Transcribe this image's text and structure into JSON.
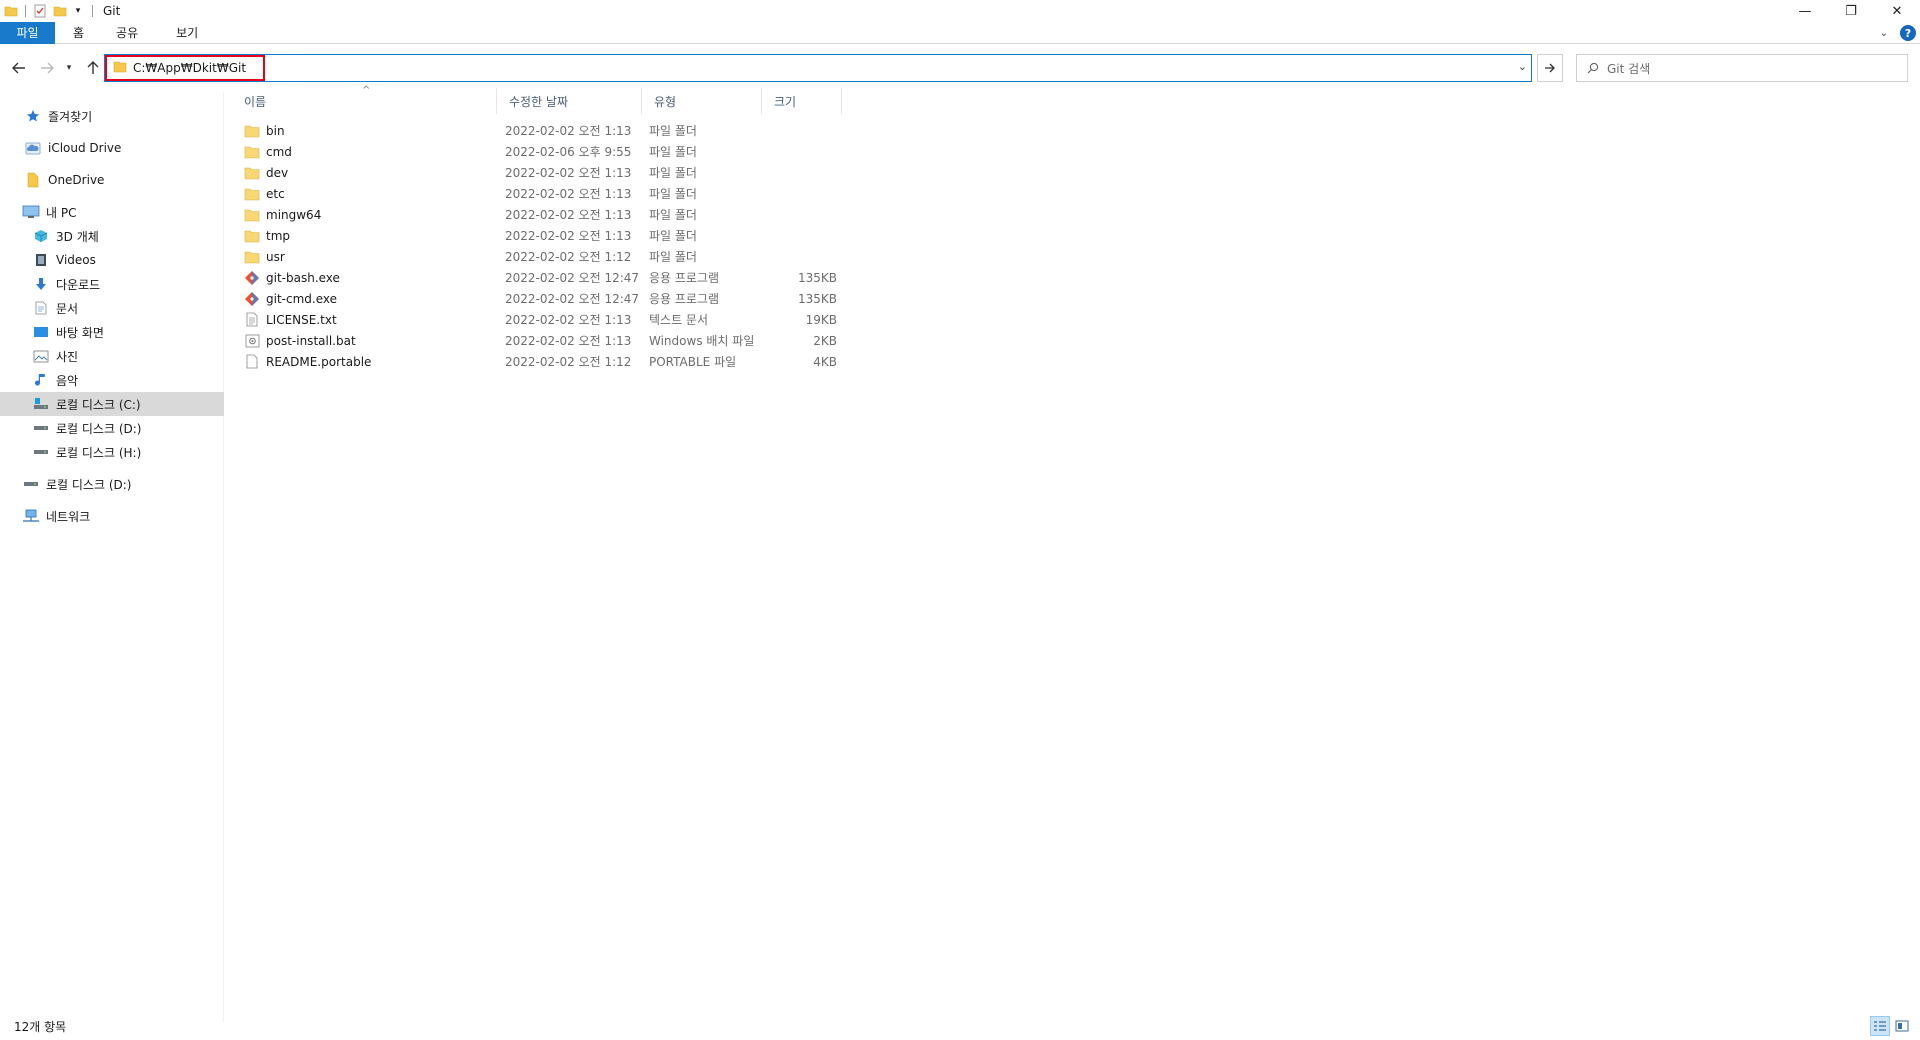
{
  "window": {
    "title": "Git",
    "controls": {
      "minimize": "—",
      "maximize": "❐",
      "close": "✕"
    }
  },
  "ribbon": {
    "tabs": [
      "파일",
      "홈",
      "공유",
      "보기"
    ],
    "help_label": "?"
  },
  "nav": {
    "address_path": "C:₩App₩Dkit₩Git",
    "search_placeholder": "Git 검색"
  },
  "sidebar": {
    "items": [
      {
        "label": "즐겨찾기",
        "icon": "star-icon"
      },
      {
        "label": "iCloud Drive",
        "icon": "icloud-icon"
      },
      {
        "label": "OneDrive",
        "icon": "folder-icon"
      },
      {
        "label": "내 PC",
        "icon": "pc-icon"
      },
      {
        "label": "3D 개체",
        "icon": "cube-icon"
      },
      {
        "label": "Videos",
        "icon": "video-icon"
      },
      {
        "label": "다운로드",
        "icon": "download-icon"
      },
      {
        "label": "문서",
        "icon": "document-icon"
      },
      {
        "label": "바탕 화면",
        "icon": "desktop-icon"
      },
      {
        "label": "사진",
        "icon": "pictures-icon"
      },
      {
        "label": "음악",
        "icon": "music-icon"
      },
      {
        "label": "로컬 디스크 (C:)",
        "icon": "drive-c-icon",
        "selected": true
      },
      {
        "label": "로컬 디스크 (D:)",
        "icon": "drive-icon"
      },
      {
        "label": "로컬 디스크 (H:)",
        "icon": "drive-icon"
      },
      {
        "label": "로컬 디스크 (D:)",
        "icon": "drive-icon"
      },
      {
        "label": "네트워크",
        "icon": "network-icon"
      }
    ]
  },
  "columns": {
    "name": "이름",
    "date": "수정한 날짜",
    "type": "유형",
    "size": "크기"
  },
  "files": [
    {
      "name": "bin",
      "date": "2022-02-02 오전 1:13",
      "type": "파일 폴더",
      "size": "",
      "icon": "folder-icon"
    },
    {
      "name": "cmd",
      "date": "2022-02-06 오후 9:55",
      "type": "파일 폴더",
      "size": "",
      "icon": "folder-icon"
    },
    {
      "name": "dev",
      "date": "2022-02-02 오전 1:13",
      "type": "파일 폴더",
      "size": "",
      "icon": "folder-icon"
    },
    {
      "name": "etc",
      "date": "2022-02-02 오전 1:13",
      "type": "파일 폴더",
      "size": "",
      "icon": "folder-icon"
    },
    {
      "name": "mingw64",
      "date": "2022-02-02 오전 1:13",
      "type": "파일 폴더",
      "size": "",
      "icon": "folder-icon"
    },
    {
      "name": "tmp",
      "date": "2022-02-02 오전 1:13",
      "type": "파일 폴더",
      "size": "",
      "icon": "folder-icon"
    },
    {
      "name": "usr",
      "date": "2022-02-02 오전 1:12",
      "type": "파일 폴더",
      "size": "",
      "icon": "folder-icon"
    },
    {
      "name": "git-bash.exe",
      "date": "2022-02-02 오전 12:47",
      "type": "응용 프로그램",
      "size": "135KB",
      "icon": "git-icon"
    },
    {
      "name": "git-cmd.exe",
      "date": "2022-02-02 오전 12:47",
      "type": "응용 프로그램",
      "size": "135KB",
      "icon": "git-icon"
    },
    {
      "name": "LICENSE.txt",
      "date": "2022-02-02 오전 1:13",
      "type": "텍스트 문서",
      "size": "19KB",
      "icon": "text-file-icon"
    },
    {
      "name": "post-install.bat",
      "date": "2022-02-02 오전 1:13",
      "type": "Windows 배치 파일",
      "size": "2KB",
      "icon": "batch-file-icon"
    },
    {
      "name": "README.portable",
      "date": "2022-02-02 오전 1:12",
      "type": "PORTABLE 파일",
      "size": "4KB",
      "icon": "blank-file-icon"
    }
  ],
  "status": {
    "item_count": "12개 항목"
  }
}
